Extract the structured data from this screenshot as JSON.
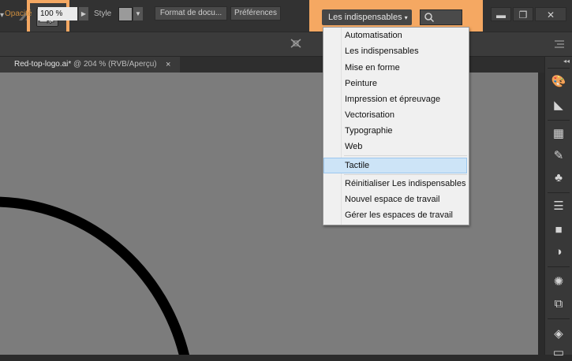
{
  "window": {
    "workspace_switcher_label": "Les indispensables",
    "search_placeholder": "",
    "buttons": [
      "minimize",
      "restore",
      "close"
    ],
    "minimize_glyph": "▬",
    "restore_glyph": "❐",
    "close_glyph": "✕",
    "menu_arrow_glyph": "▾",
    "highlight_color": "#f5a862"
  },
  "control_bar": {
    "opacity_label": "Opacité",
    "opacity_value": "100 %",
    "style_label": "Style",
    "document_format_button": "Format de docu...",
    "preferences_button": "Préférences",
    "arrow_glyph": "▶",
    "dropdown_glyph": "▼"
  },
  "document_tab": {
    "name": "Red-top-logo.ai*",
    "info": " @ 204 % (RVB/Aperçu)",
    "close_glyph": "×"
  },
  "workspace_menu": {
    "items": [
      "Automatisation",
      "Les indispensables",
      "Mise en forme",
      "Peinture",
      "Impression et épreuvage",
      "Vectorisation",
      "Typographie",
      "Web"
    ],
    "highlighted_item": "Tactile",
    "actions": [
      "Réinitialiser Les indispensables",
      "Nouvel espace de travail",
      "Gérer les espaces de travail"
    ]
  },
  "dock": {
    "icons": [
      "color-palette-icon",
      "color-guide-icon",
      "swatches-icon",
      "brushes-icon",
      "symbols-icon",
      "stroke-icon",
      "gradient-icon",
      "transparency-icon",
      "appearance-icon",
      "graphic-styles-icon",
      "layers-icon"
    ]
  }
}
